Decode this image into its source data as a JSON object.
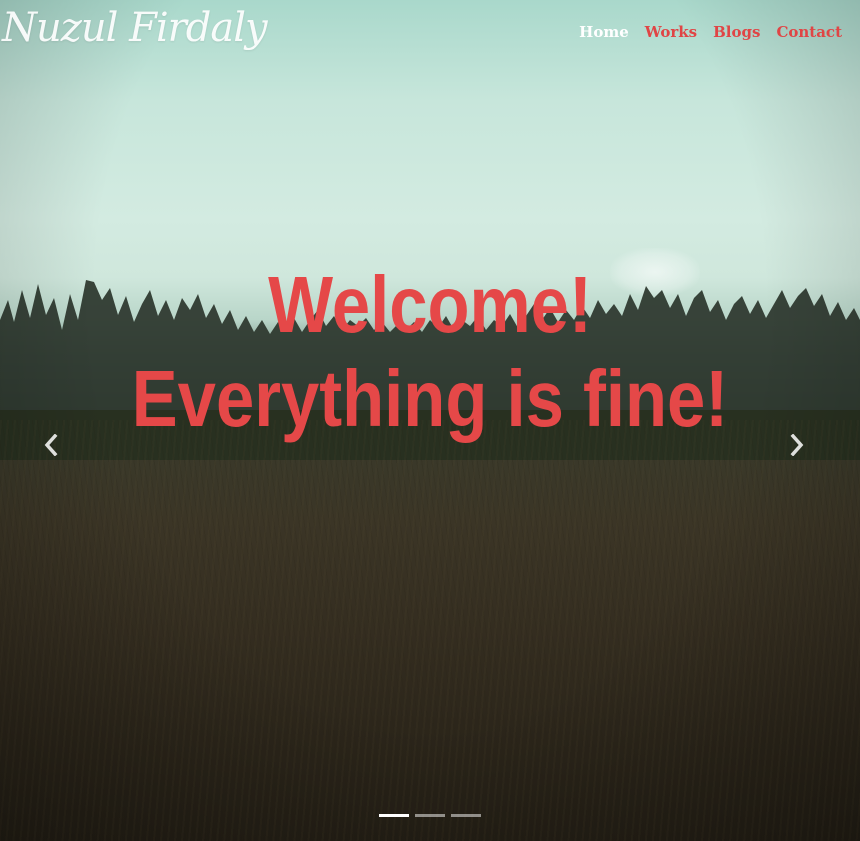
{
  "brand": {
    "name": "Nuzul Firdaly"
  },
  "nav": {
    "items": [
      {
        "label": "Home",
        "active": true
      },
      {
        "label": "Works",
        "active": false
      },
      {
        "label": "Blogs",
        "active": false
      },
      {
        "label": "Contact",
        "active": false
      }
    ]
  },
  "carousel": {
    "caption": {
      "line1": "Welcome!",
      "line2": "Everything is fine!"
    },
    "controls": {
      "prev_icon": "chevron-left-icon",
      "next_icon": "chevron-right-icon"
    },
    "slide_count": 3,
    "active_slide": 1
  },
  "colors": {
    "accent": "#e54848",
    "nav_link": "#e04545",
    "nav_active": "#ffffff",
    "indicator_active": "#ffffff",
    "indicator_inactive": "rgba(255,255,255,0.5)"
  }
}
